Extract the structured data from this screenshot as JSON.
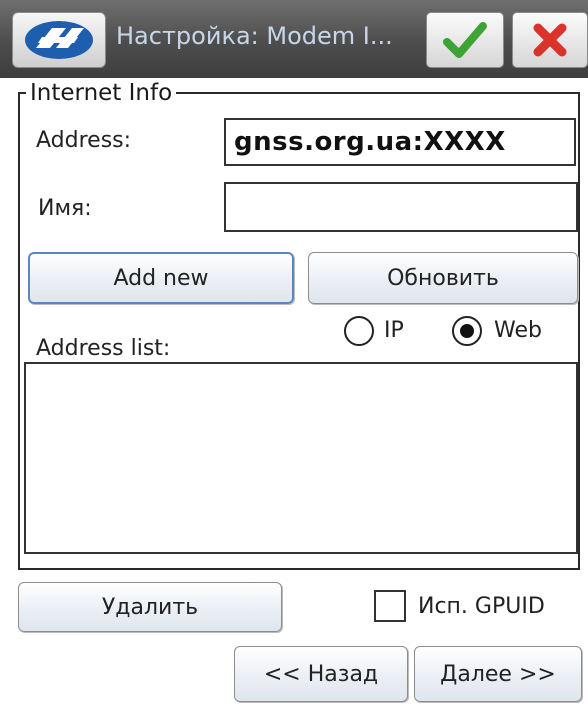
{
  "titlebar": {
    "title": "Настройка: Modem I...",
    "logo_icon": "app-logo-icon",
    "ok_icon": "checkmark-icon",
    "cancel_icon": "close-icon",
    "ok_color": "#3ca334",
    "cancel_color": "#d9332b"
  },
  "group": {
    "legend": "Internet Info"
  },
  "form": {
    "address_label": "Address:",
    "address_value": "gnss.org.ua:XXXX",
    "name_label": "Имя:",
    "name_value": "",
    "add_new_label": "Add new",
    "refresh_label": "Обновить",
    "address_list_label": "Address list:",
    "radio_ip_label": "IP",
    "radio_web_label": "Web",
    "selected_radio": "Web",
    "address_list_items": []
  },
  "footer": {
    "delete_label": "Удалить",
    "checkbox_label": "Исп. GPUID",
    "checkbox_checked": false,
    "back_label": "<< Назад",
    "next_label": "Далее >>"
  }
}
